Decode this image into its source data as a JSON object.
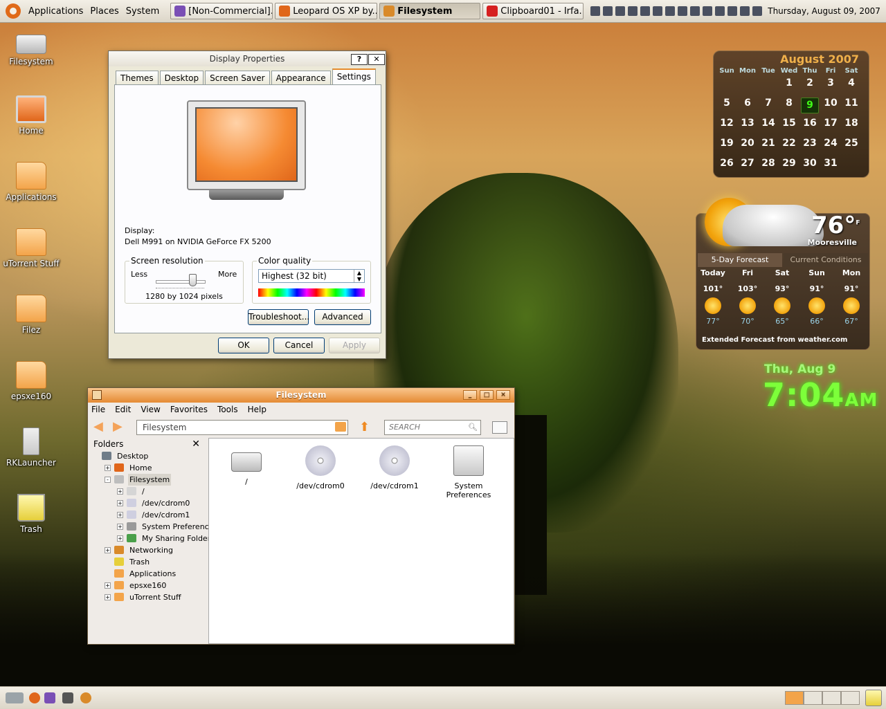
{
  "top_panel": {
    "menus": [
      "Applications",
      "Places",
      "System"
    ],
    "tasks": [
      {
        "label": "[Non-Commercial]...",
        "active": false,
        "color": "#7a4fb5"
      },
      {
        "label": "Leopard OS XP by...",
        "active": false,
        "color": "#e0661a"
      },
      {
        "label": "Filesystem",
        "active": true,
        "color": "#d98a2a"
      },
      {
        "label": "Clipboard01 - Irfa...",
        "active": false,
        "color": "#d62020"
      }
    ],
    "datetime": "Thursday, August 09, 2007"
  },
  "desktop_icons": [
    {
      "label": "Filesystem",
      "icon": "drive-icon"
    },
    {
      "label": "Home",
      "icon": "computer-icon"
    },
    {
      "label": "Applications",
      "icon": "folder-icon"
    },
    {
      "label": "uTorrent Stuff",
      "icon": "folder-icon"
    },
    {
      "label": "Filez",
      "icon": "folder-icon"
    },
    {
      "label": "epsxe160",
      "icon": "folder-icon"
    },
    {
      "label": "RKLauncher",
      "icon": "server-icon"
    },
    {
      "label": "Trash",
      "icon": "trash-icon"
    }
  ],
  "display_properties": {
    "title": "Display Properties",
    "help_label": "?",
    "close_label": "✕",
    "tabs": [
      "Themes",
      "Desktop",
      "Screen Saver",
      "Appearance",
      "Settings"
    ],
    "active_tab": "Settings",
    "display_label": "Display:",
    "display_value": "Dell M991 on NVIDIA GeForce FX 5200",
    "resolution_group": "Screen resolution",
    "less_label": "Less",
    "more_label": "More",
    "resolution_value": "1280 by 1024 pixels",
    "resolution_slider_level": 0.75,
    "color_group": "Color quality",
    "color_value": "Highest (32 bit)",
    "troubleshoot_label": "Troubleshoot...",
    "advanced_label": "Advanced",
    "ok_label": "OK",
    "cancel_label": "Cancel",
    "apply_label": "Apply"
  },
  "filesystem_window": {
    "title": "Filesystem",
    "menus": [
      "File",
      "Edit",
      "View",
      "Favorites",
      "Tools",
      "Help"
    ],
    "location": "Filesystem",
    "search_placeholder": "SEARCH",
    "sidebar_title": "Folders",
    "tree": [
      {
        "label": "Desktop",
        "depth": 0,
        "expander": "",
        "selected": false,
        "icon_color": "#6f7c88"
      },
      {
        "label": "Home",
        "depth": 1,
        "expander": "+",
        "selected": false,
        "icon_color": "#e0661a"
      },
      {
        "label": "Filesystem",
        "depth": 1,
        "expander": "−",
        "selected": true,
        "icon_color": "#bdbdbd"
      },
      {
        "label": "/",
        "depth": 2,
        "expander": "+",
        "selected": false,
        "icon_color": "#d5d5d5"
      },
      {
        "label": "/dev/cdrom0",
        "depth": 2,
        "expander": "+",
        "selected": false,
        "icon_color": "#cfcfe0"
      },
      {
        "label": "/dev/cdrom1",
        "depth": 2,
        "expander": "+",
        "selected": false,
        "icon_color": "#cfcfe0"
      },
      {
        "label": "System Preferences",
        "depth": 2,
        "expander": "+",
        "selected": false,
        "icon_color": "#9a9a9a"
      },
      {
        "label": "My Sharing Folders",
        "depth": 2,
        "expander": "+",
        "selected": false,
        "icon_color": "#4aa04a"
      },
      {
        "label": "Networking",
        "depth": 1,
        "expander": "+",
        "selected": false,
        "icon_color": "#d98a2a"
      },
      {
        "label": "Trash",
        "depth": 1,
        "expander": "",
        "selected": false,
        "icon_color": "#e6cf3a"
      },
      {
        "label": "Applications",
        "depth": 1,
        "expander": "",
        "selected": false,
        "icon_color": "#f3a44a"
      },
      {
        "label": "epsxe160",
        "depth": 1,
        "expander": "+",
        "selected": false,
        "icon_color": "#f3a44a"
      },
      {
        "label": "uTorrent Stuff",
        "depth": 1,
        "expander": "+",
        "selected": false,
        "icon_color": "#f3a44a"
      }
    ],
    "items": [
      {
        "label": "/",
        "icon": "hard-drive-icon"
      },
      {
        "label": "/dev/cdrom0",
        "icon": "cdrom-icon"
      },
      {
        "label": "/dev/cdrom1",
        "icon": "cdrom-icon"
      },
      {
        "label": "System Preferences",
        "icon": "preferences-icon"
      }
    ]
  },
  "calendar": {
    "title": "August 2007",
    "weekdays": [
      "Sun",
      "Mon",
      "Tue",
      "Wed",
      "Thu",
      "Fri",
      "Sat"
    ],
    "first_weekday": 3,
    "days_in_month": 31,
    "today": 9
  },
  "weather": {
    "temperature": "76°",
    "unit": "F",
    "city": "Mooresville",
    "tab_forecast": "5-Day Forecast",
    "tab_current": "Current Conditions",
    "forecast": [
      {
        "day": "Today",
        "high": "101°",
        "low": "77°",
        "condition": "sunny-icon"
      },
      {
        "day": "Fri",
        "high": "103°",
        "low": "70°",
        "condition": "thunderstorm-icon"
      },
      {
        "day": "Sat",
        "high": "93°",
        "low": "65°",
        "condition": "partly-cloudy-icon"
      },
      {
        "day": "Sun",
        "high": "91°",
        "low": "66°",
        "condition": "sunny-icon"
      },
      {
        "day": "Mon",
        "high": "91°",
        "low": "67°",
        "condition": "sunny-icon"
      }
    ],
    "footer": "Extended Forecast from weather.com"
  },
  "digital_clock": {
    "date": "Thu, Aug 9",
    "time": "7:04",
    "ampm": "AM"
  }
}
